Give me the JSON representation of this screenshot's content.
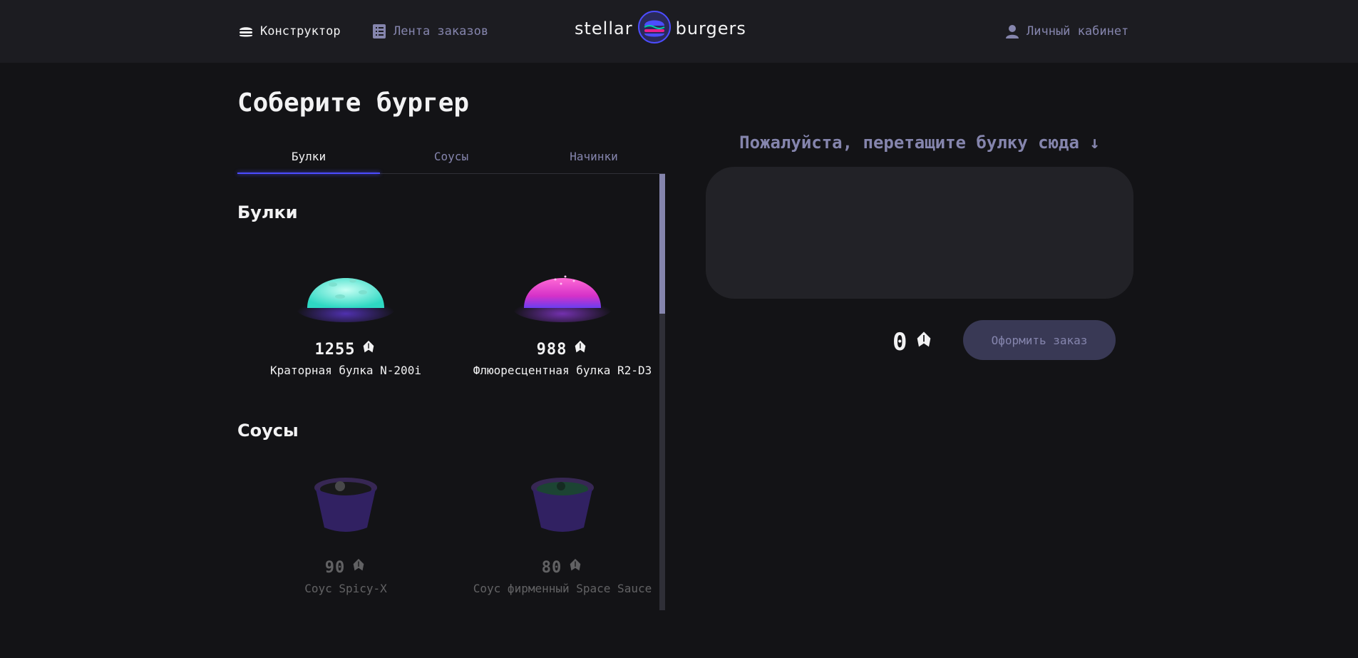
{
  "header": {
    "nav_constructor": "Конструктор",
    "nav_feed": "Лента заказов",
    "nav_account": "Личный кабинет",
    "logo_left": "stellar",
    "logo_right": "burgers"
  },
  "main": {
    "title": "Соберите бургер",
    "tabs": [
      "Булки",
      "Соусы",
      "Начинки"
    ],
    "active_tab": "Булки",
    "sections": {
      "buns": {
        "title": "Булки",
        "items": [
          {
            "price": "1255",
            "name": "Краторная булка N-200i"
          },
          {
            "price": "988",
            "name": "Флюоресцентная булка R2-D3"
          }
        ]
      },
      "sauces": {
        "title": "Соусы",
        "items": [
          {
            "price": "90",
            "name": "Соус Spicy-X"
          },
          {
            "price": "80",
            "name": "Соус фирменный Space Sauce"
          }
        ]
      }
    }
  },
  "constructor": {
    "drop_hint": "Пожалуйста, перетащите булку сюда ↓",
    "total": "0",
    "order_button": "Оформить заказ"
  },
  "colors": {
    "background": "#131316",
    "header": "#1c1c21",
    "accent": "#4c4cff",
    "muted_text": "#8585ad",
    "button": "#393955"
  },
  "icons": [
    "burger-icon",
    "list-icon",
    "profile-icon",
    "currency-icon",
    "arrow-down-icon"
  ]
}
